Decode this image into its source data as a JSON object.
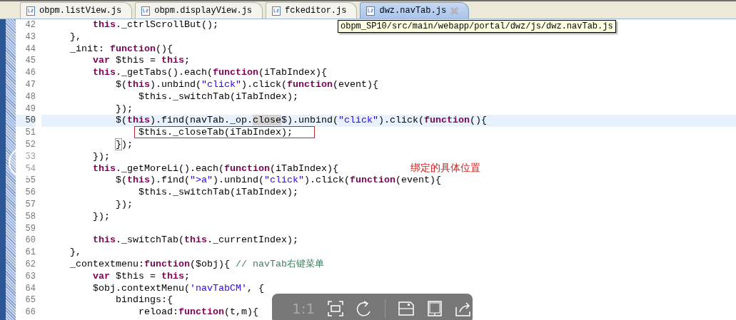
{
  "tabs": [
    {
      "label": "obpm.listView.js",
      "selected": false
    },
    {
      "label": "obpm.displayView.js",
      "selected": false
    },
    {
      "label": "fckeditor.js",
      "selected": false
    },
    {
      "label": "dwz.navTab.js",
      "selected": true
    }
  ],
  "tooltip": "obpm_SP10/src/main/webapp/portal/dwz/js/dwz.navTab.js",
  "lines": [
    {
      "number": "42",
      "current": false,
      "segments": [
        {
          "text": "        this",
          "kind": "keyword"
        },
        {
          "text": "._ctrlScrollBut();",
          "kind": "plain"
        }
      ]
    },
    {
      "number": "43",
      "current": false,
      "segments": [
        {
          "text": "    },",
          "kind": "plain"
        }
      ]
    },
    {
      "number": "44",
      "current": false,
      "segments": [
        {
          "text": "    _init: ",
          "kind": "plain"
        },
        {
          "text": "function",
          "kind": "keyword"
        },
        {
          "text": "(){",
          "kind": "plain"
        }
      ]
    },
    {
      "number": "45",
      "current": false,
      "segments": [
        {
          "text": "        var",
          "kind": "keyword"
        },
        {
          "text": " $this = ",
          "kind": "plain"
        },
        {
          "text": "this",
          "kind": "keyword"
        },
        {
          "text": ";",
          "kind": "plain"
        }
      ]
    },
    {
      "number": "46",
      "current": false,
      "segments": [
        {
          "text": "        this",
          "kind": "keyword"
        },
        {
          "text": "._getTabs().each(",
          "kind": "plain"
        },
        {
          "text": "function",
          "kind": "keyword"
        },
        {
          "text": "(iTabIndex){",
          "kind": "plain"
        }
      ]
    },
    {
      "number": "47",
      "current": false,
      "segments": [
        {
          "text": "            $(",
          "kind": "plain"
        },
        {
          "text": "this",
          "kind": "keyword"
        },
        {
          "text": ").unbind(",
          "kind": "plain"
        },
        {
          "text": "\"click\"",
          "kind": "string"
        },
        {
          "text": ").click(",
          "kind": "plain"
        },
        {
          "text": "function",
          "kind": "keyword"
        },
        {
          "text": "(event){",
          "kind": "plain"
        }
      ]
    },
    {
      "number": "48",
      "current": false,
      "segments": [
        {
          "text": "                $this._switchTab(iTabIndex);",
          "kind": "plain"
        }
      ]
    },
    {
      "number": "49",
      "current": false,
      "segments": [
        {
          "text": "            });",
          "kind": "plain"
        }
      ]
    },
    {
      "number": "50",
      "current": true,
      "segments": [
        {
          "text": "            $(",
          "kind": "plain"
        },
        {
          "text": "this",
          "kind": "keyword"
        },
        {
          "text": ").find(navTab._op.",
          "kind": "plain"
        },
        {
          "text": "close",
          "kind": "occurrence"
        },
        {
          "text": "$).unbind(",
          "kind": "plain"
        },
        {
          "text": "\"click\"",
          "kind": "string"
        },
        {
          "text": ").click(",
          "kind": "plain"
        },
        {
          "text": "function",
          "kind": "keyword"
        },
        {
          "text": "(){",
          "kind": "plain"
        }
      ]
    },
    {
      "number": "51",
      "current": false,
      "segments": [
        {
          "text": "                $this._closeTab(iTabIndex);",
          "kind": "boxed"
        }
      ]
    },
    {
      "number": "52",
      "current": false,
      "segments": [
        {
          "text": "            }",
          "kind": "bracket"
        },
        {
          "text": ");",
          "kind": "plain"
        }
      ]
    },
    {
      "number": "53",
      "current": false,
      "segments": [
        {
          "text": "        });",
          "kind": "plain"
        }
      ]
    },
    {
      "number": "54",
      "current": false,
      "segments": [
        {
          "text": "        this",
          "kind": "keyword"
        },
        {
          "text": "._getMoreLi().each(",
          "kind": "plain"
        },
        {
          "text": "function",
          "kind": "keyword"
        },
        {
          "text": "(iTabIndex){",
          "kind": "plain"
        }
      ]
    },
    {
      "number": "55",
      "current": false,
      "segments": [
        {
          "text": "            $(",
          "kind": "plain"
        },
        {
          "text": "this",
          "kind": "keyword"
        },
        {
          "text": ").find(",
          "kind": "plain"
        },
        {
          "text": "\">a\"",
          "kind": "string"
        },
        {
          "text": ").unbind(",
          "kind": "plain"
        },
        {
          "text": "\"click\"",
          "kind": "string"
        },
        {
          "text": ").click(",
          "kind": "plain"
        },
        {
          "text": "function",
          "kind": "keyword"
        },
        {
          "text": "(event){",
          "kind": "plain"
        }
      ]
    },
    {
      "number": "56",
      "current": false,
      "segments": [
        {
          "text": "                $this._switchTab(iTabIndex);",
          "kind": "plain"
        }
      ]
    },
    {
      "number": "57",
      "current": false,
      "segments": [
        {
          "text": "            });",
          "kind": "plain"
        }
      ]
    },
    {
      "number": "58",
      "current": false,
      "segments": [
        {
          "text": "        });",
          "kind": "plain"
        }
      ]
    },
    {
      "number": "59",
      "current": false
    },
    {
      "number": "60",
      "current": false,
      "segments": [
        {
          "text": "        this",
          "kind": "keyword"
        },
        {
          "text": "._switchTab(",
          "kind": "plain"
        },
        {
          "text": "this",
          "kind": "keyword"
        },
        {
          "text": "._currentIndex);",
          "kind": "plain"
        }
      ]
    },
    {
      "number": "61",
      "current": false,
      "segments": [
        {
          "text": "    },",
          "kind": "plain"
        }
      ]
    },
    {
      "number": "62",
      "current": false,
      "segments": [
        {
          "text": "    _contextmenu:",
          "kind": "plain"
        },
        {
          "text": "function",
          "kind": "keyword"
        },
        {
          "text": "($obj){ ",
          "kind": "plain"
        },
        {
          "text": "// navTab右键菜单",
          "kind": "comment"
        }
      ]
    },
    {
      "number": "63",
      "current": false,
      "segments": [
        {
          "text": "        var",
          "kind": "keyword"
        },
        {
          "text": " $this = ",
          "kind": "plain"
        },
        {
          "text": "this",
          "kind": "keyword"
        },
        {
          "text": ";",
          "kind": "plain"
        }
      ]
    },
    {
      "number": "64",
      "current": false,
      "segments": [
        {
          "text": "        $obj.contextMenu(",
          "kind": "plain"
        },
        {
          "text": "'navTabCM'",
          "kind": "string"
        },
        {
          "text": ", {",
          "kind": "plain"
        }
      ]
    },
    {
      "number": "65",
      "current": false,
      "segments": [
        {
          "text": "            bindings:{",
          "kind": "plain"
        }
      ]
    },
    {
      "number": "66",
      "current": false,
      "segments": [
        {
          "text": "                reload:",
          "kind": "plain"
        },
        {
          "text": "function",
          "kind": "keyword"
        },
        {
          "text": "(t,m){",
          "kind": "plain"
        }
      ]
    }
  ],
  "annotation": "绑定的具体位置",
  "viewer_toolbar": {
    "zoom_label": "1:1"
  }
}
